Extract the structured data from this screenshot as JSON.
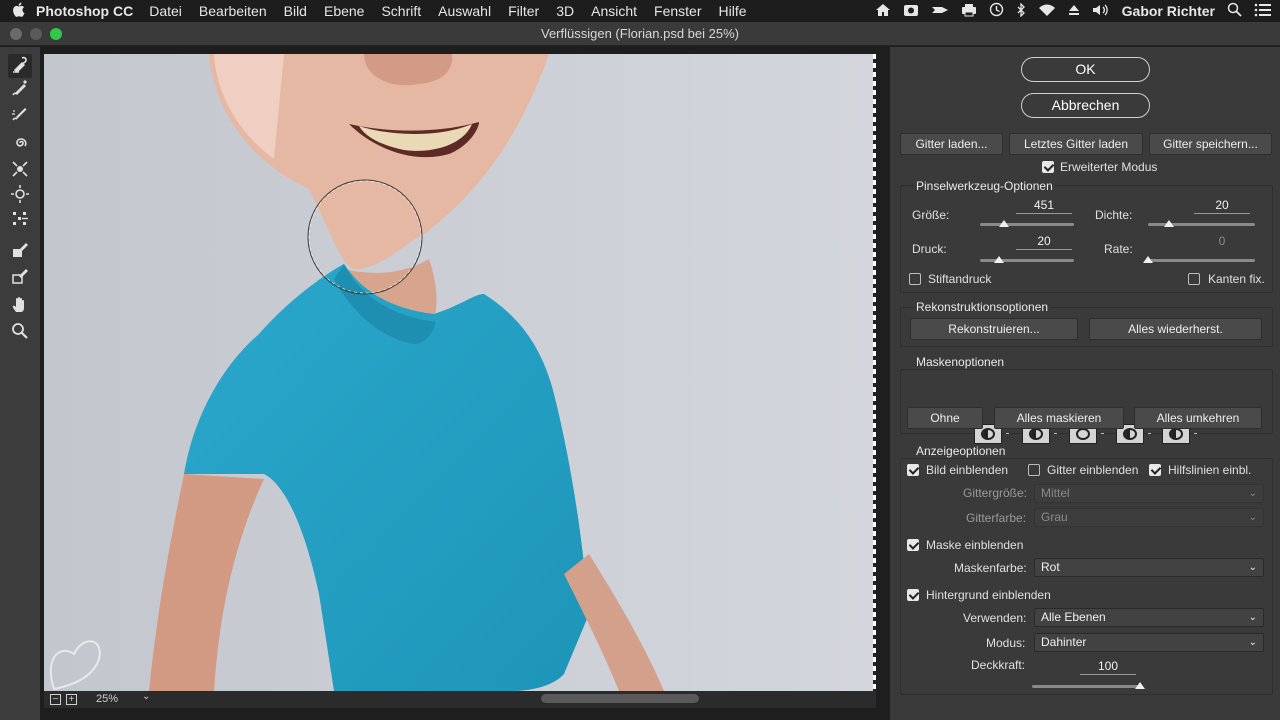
{
  "menubar": {
    "apple": "",
    "app": "Photoshop CC",
    "items": [
      "Datei",
      "Bearbeiten",
      "Bild",
      "Ebene",
      "Schrift",
      "Auswahl",
      "Filter",
      "3D",
      "Ansicht",
      "Fenster",
      "Hilfe"
    ],
    "user": "Gabor Richter"
  },
  "window": {
    "title": "Verflüssigen (Florian.psd bei 25%)",
    "close_color": "#fc605c",
    "min_color": "#5a5a5a",
    "zoom_color": "#34c84a"
  },
  "tools": [
    {
      "name": "vorwaerts-krummen",
      "icon": "forward-warp-icon"
    },
    {
      "name": "rekonstruktion",
      "icon": "reconstruct-brush-icon"
    },
    {
      "name": "glaetten",
      "icon": "smooth-brush-icon"
    },
    {
      "name": "strudel",
      "icon": "twirl-icon"
    },
    {
      "name": "zusammenziehen",
      "icon": "pucker-icon"
    },
    {
      "name": "aufblasen",
      "icon": "bloat-icon"
    },
    {
      "name": "pixel-verschieben",
      "icon": "push-left-icon"
    },
    {
      "name": "maske-fixieren",
      "icon": "freeze-mask-icon"
    },
    {
      "name": "maske-loesen",
      "icon": "thaw-mask-icon"
    },
    {
      "name": "hand",
      "icon": "hand-icon"
    },
    {
      "name": "zoom",
      "icon": "zoom-icon"
    }
  ],
  "status": {
    "zoom_value": "25%"
  },
  "panel": {
    "ok": "OK",
    "cancel": "Abbrechen",
    "load_mesh": "Gitter laden...",
    "load_last_mesh": "Letztes Gitter laden",
    "save_mesh": "Gitter speichern...",
    "advanced_mode": "Erweiterter Modus",
    "advanced_mode_checked": true,
    "brush": {
      "title": "Pinselwerkzeug-Optionen",
      "size_label": "Größe:",
      "size": "451",
      "size_level": 0.26,
      "density_label": "Dichte:",
      "density": "20",
      "density_level": 0.2,
      "pressure_label": "Druck:",
      "pressure": "20",
      "pressure_level": 0.2,
      "rate_label": "Rate:",
      "rate": "0",
      "rate_level": 0,
      "stylus_label": "Stiftandruck",
      "stylus_checked": false,
      "pin_edges_label": "Kanten fix.",
      "pin_edges_checked": false
    },
    "reconstruct": {
      "title": "Rekonstruktionsoptionen",
      "reconstruct_btn": "Rekonstruieren...",
      "restore_all_btn": "Alles wiederherst."
    },
    "mask": {
      "title": "Maskenoptionen",
      "none": "Ohne",
      "mask_all": "Alles maskieren",
      "invert_all": "Alles umkehren"
    },
    "view": {
      "title": "Anzeigeoptionen",
      "show_image": "Bild einblenden",
      "show_image_checked": true,
      "show_mesh": "Gitter einblenden",
      "show_mesh_checked": false,
      "show_guides": "Hilfslinien einbl.",
      "show_guides_checked": true,
      "mesh_size_label": "Gittergröße:",
      "mesh_size": "Mittel",
      "mesh_color_label": "Gitterfarbe:",
      "mesh_color": "Grau",
      "show_mask": "Maske einblenden",
      "show_mask_checked": true,
      "mask_color_label": "Maskenfarbe:",
      "mask_color": "Rot",
      "show_backdrop": "Hintergrund einblenden",
      "show_backdrop_checked": true,
      "use_label": "Verwenden:",
      "use": "Alle Ebenen",
      "mode_label": "Modus:",
      "mode": "Dahinter",
      "opacity_label": "Deckkraft:",
      "opacity": "100",
      "opacity_level": 1.0
    }
  }
}
